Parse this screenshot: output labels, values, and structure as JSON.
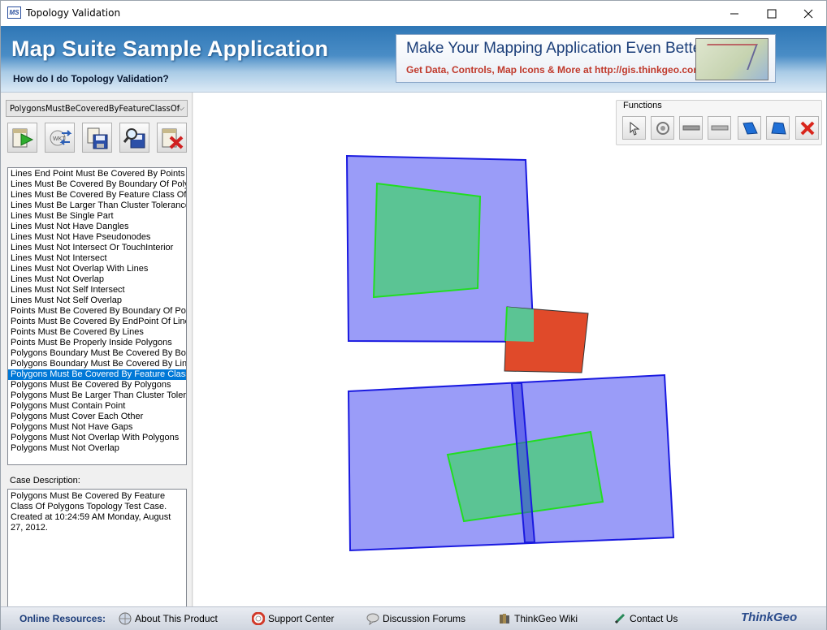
{
  "window": {
    "title": "Topology Validation",
    "app_icon_text": "MS",
    "controls": {
      "minimize": "—",
      "maximize": "☐",
      "close": "✕"
    }
  },
  "banner": {
    "title": "Map Suite Sample Application",
    "subtitle": "How do I do Topology Validation?",
    "ad_headline": "Make Your Mapping Application Even Better.",
    "ad_text": "Get Data, Controls, Map Icons & More at http://gis.thinkgeo.com"
  },
  "left": {
    "combo_value": "PolygonsMustBeCoveredByFeatureClassOf",
    "toolbar": [
      "run-validation-icon",
      "import-wkt-icon",
      "save-icon",
      "zoom-to-icon",
      "clear-icon"
    ],
    "rules": [
      "Lines End Point Must Be Covered By Points",
      "Lines Must Be Covered By Boundary Of Polygons",
      "Lines Must Be Covered By Feature Class Of Lines",
      "Lines Must Be Larger Than Cluster Tolerance",
      "Lines Must Be Single Part",
      "Lines Must Not Have Dangles",
      "Lines Must Not Have Pseudonodes",
      "Lines Must Not Intersect Or TouchInterior",
      "Lines Must Not Intersect",
      "Lines Must Not Overlap With Lines",
      "Lines Must Not Overlap",
      "Lines Must Not Self Intersect",
      "Lines Must Not Self Overlap",
      "Points Must Be Covered By Boundary Of Polygons",
      "Points Must Be Covered By EndPoint Of Lines",
      "Points Must Be Covered By Lines",
      "Points Must Be Properly Inside Polygons",
      "Polygons Boundary Must Be Covered By Boundary",
      "Polygons Boundary Must Be Covered By Lines",
      "Polygons Must Be Covered By Feature Class Of",
      "Polygons Must Be Covered By Polygons",
      "Polygons Must Be Larger Than Cluster Tolerance",
      "Polygons Must Contain Point",
      "Polygons Must Cover Each Other",
      "Polygons Must Not Have Gaps",
      "Polygons Must Not Overlap With Polygons",
      "Polygons Must Not Overlap"
    ],
    "selected_index": 19,
    "case_label": "Case Description:",
    "case_description": "Polygons Must Be Covered By Feature Class Of Polygons Topology Test Case. Created at 10:24:59 AM Monday, August 27, 2012."
  },
  "functions": {
    "label": "Functions",
    "buttons": [
      "pointer-icon",
      "draw-circle-icon",
      "line-tool-icon",
      "line-tool-2-icon",
      "polygon-tool-icon",
      "polygon-tool-2-icon",
      "delete-icon"
    ]
  },
  "colors": {
    "cover_fill": "#9a9cf8",
    "cover_stroke": "#1a1ae0",
    "feature_fill": "#5bc494",
    "feature_stroke": "#22dd22",
    "error_fill": "#e04a2a",
    "selection": "#0078d7"
  },
  "footer": {
    "label": "Online Resources:",
    "links": [
      "About This Product",
      "Support Center",
      "Discussion Forums",
      "ThinkGeo Wiki",
      "Contact Us"
    ],
    "brand": "ThinkGeo"
  }
}
